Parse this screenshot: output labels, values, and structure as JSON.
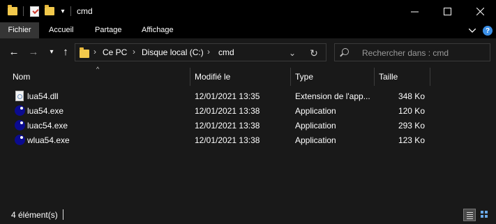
{
  "window": {
    "title": "cmd",
    "qat_dropdown": "▾"
  },
  "ribbon": {
    "tabs": [
      "Fichier",
      "Accueil",
      "Partage",
      "Affichage"
    ],
    "active_tab": "Fichier",
    "expand_icon": "chevron-down-icon",
    "help_icon": "help-icon",
    "help_glyph": "?"
  },
  "nav": {
    "back": "←",
    "forward": "→",
    "recent": "▾",
    "up": "↑",
    "breadcrumb": [
      "Ce PC",
      "Disque local (C:)",
      "cmd"
    ],
    "crumb_separator": "›",
    "history_dropdown": "⌄",
    "refresh": "↻",
    "search_placeholder": "Rechercher dans : cmd"
  },
  "columns": [
    "Nom",
    "Modifié le",
    "Type",
    "Taille"
  ],
  "sort_indicator": "^",
  "files": [
    {
      "name": "lua54.dll",
      "modified": "12/01/2021 13:35",
      "type": "Extension de l'app...",
      "size": "348 Ko",
      "icon": "dll-file-icon"
    },
    {
      "name": "lua54.exe",
      "modified": "12/01/2021 13:38",
      "type": "Application",
      "size": "120 Ko",
      "icon": "lua-exe-icon"
    },
    {
      "name": "luac54.exe",
      "modified": "12/01/2021 13:38",
      "type": "Application",
      "size": "293 Ko",
      "icon": "lua-exe-icon"
    },
    {
      "name": "wlua54.exe",
      "modified": "12/01/2021 13:38",
      "type": "Application",
      "size": "123 Ko",
      "icon": "lua-exe-icon"
    }
  ],
  "status": {
    "count_text": "4 élément(s)"
  },
  "colors": {
    "titlebar": "#000000",
    "background": "#191919",
    "active_tab": "#353535",
    "folder": "#f2c94c",
    "lua_blue": "#0b0b8f",
    "help_blue": "#3a8ee6"
  }
}
